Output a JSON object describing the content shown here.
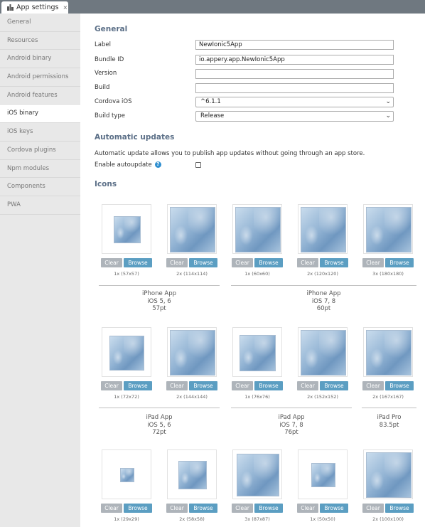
{
  "tab": {
    "title": "App settings",
    "close": "×"
  },
  "sidebar": {
    "items": [
      {
        "label": "General"
      },
      {
        "label": "Resources"
      },
      {
        "label": "Android binary"
      },
      {
        "label": "Android permissions"
      },
      {
        "label": "Android features"
      },
      {
        "label": "iOS binary",
        "active": true
      },
      {
        "label": "iOS keys"
      },
      {
        "label": "Cordova plugins"
      },
      {
        "label": "Npm modules"
      },
      {
        "label": "Components"
      },
      {
        "label": "PWA"
      }
    ]
  },
  "general": {
    "title": "General",
    "fields": {
      "label": {
        "label": "Label",
        "value": "NewIonic5App"
      },
      "bundle_id": {
        "label": "Bundle ID",
        "value": "io.appery.app.NewIonic5App"
      },
      "version": {
        "label": "Version",
        "value": ""
      },
      "build": {
        "label": "Build",
        "value": ""
      },
      "cordova_ios": {
        "label": "Cordova iOS",
        "value": "^6.1.1"
      },
      "build_type": {
        "label": "Build type",
        "value": "Release"
      }
    }
  },
  "updates": {
    "title": "Automatic updates",
    "description": "Automatic update allows you to publish app updates without going through an app store.",
    "enable_label": "Enable autoupdate",
    "help": "?",
    "enabled": false
  },
  "icons": {
    "title": "Icons",
    "clear_label": "Clear",
    "browse_label": "Browse",
    "rows": [
      {
        "cells": [
          {
            "size": "1x (57x57)"
          },
          {
            "size": "2x (114x114)"
          },
          {
            "size": "1x (60x60)"
          },
          {
            "size": "2x (120x120)"
          },
          {
            "size": "3x (180x180)"
          }
        ],
        "groups": [
          {
            "line1": "iPhone App",
            "line2": "iOS 5, 6",
            "line3": "57pt"
          },
          {
            "line1": "iPhone App",
            "line2": "iOS 7, 8",
            "line3": "60pt"
          }
        ]
      },
      {
        "cells": [
          {
            "size": "1x (72x72)"
          },
          {
            "size": "2x (144x144)"
          },
          {
            "size": "1x (76x76)"
          },
          {
            "size": "2x (152x152)"
          },
          {
            "size": "2x (167x167)"
          }
        ],
        "groups": [
          {
            "line1": "iPad App",
            "line2": "iOS 5, 6",
            "line3": "72pt"
          },
          {
            "line1": "iPad App",
            "line2": "iOS 7, 8",
            "line3": "76pt"
          },
          {
            "line1": "iPad Pro",
            "line2": "83.5pt",
            "line3": ""
          }
        ]
      },
      {
        "cells": [
          {
            "size": "1x (29x29)"
          },
          {
            "size": "2x (58x58)"
          },
          {
            "size": "3x (87x87)"
          },
          {
            "size": "1x (50x50)"
          },
          {
            "size": "2x (100x100)"
          }
        ]
      }
    ]
  },
  "colors": {
    "tabbar": "#6f7880",
    "section_title": "#5b6f87",
    "browse": "#5b9ec2",
    "clear": "#aeb4ba",
    "help": "#2f8fd0"
  }
}
